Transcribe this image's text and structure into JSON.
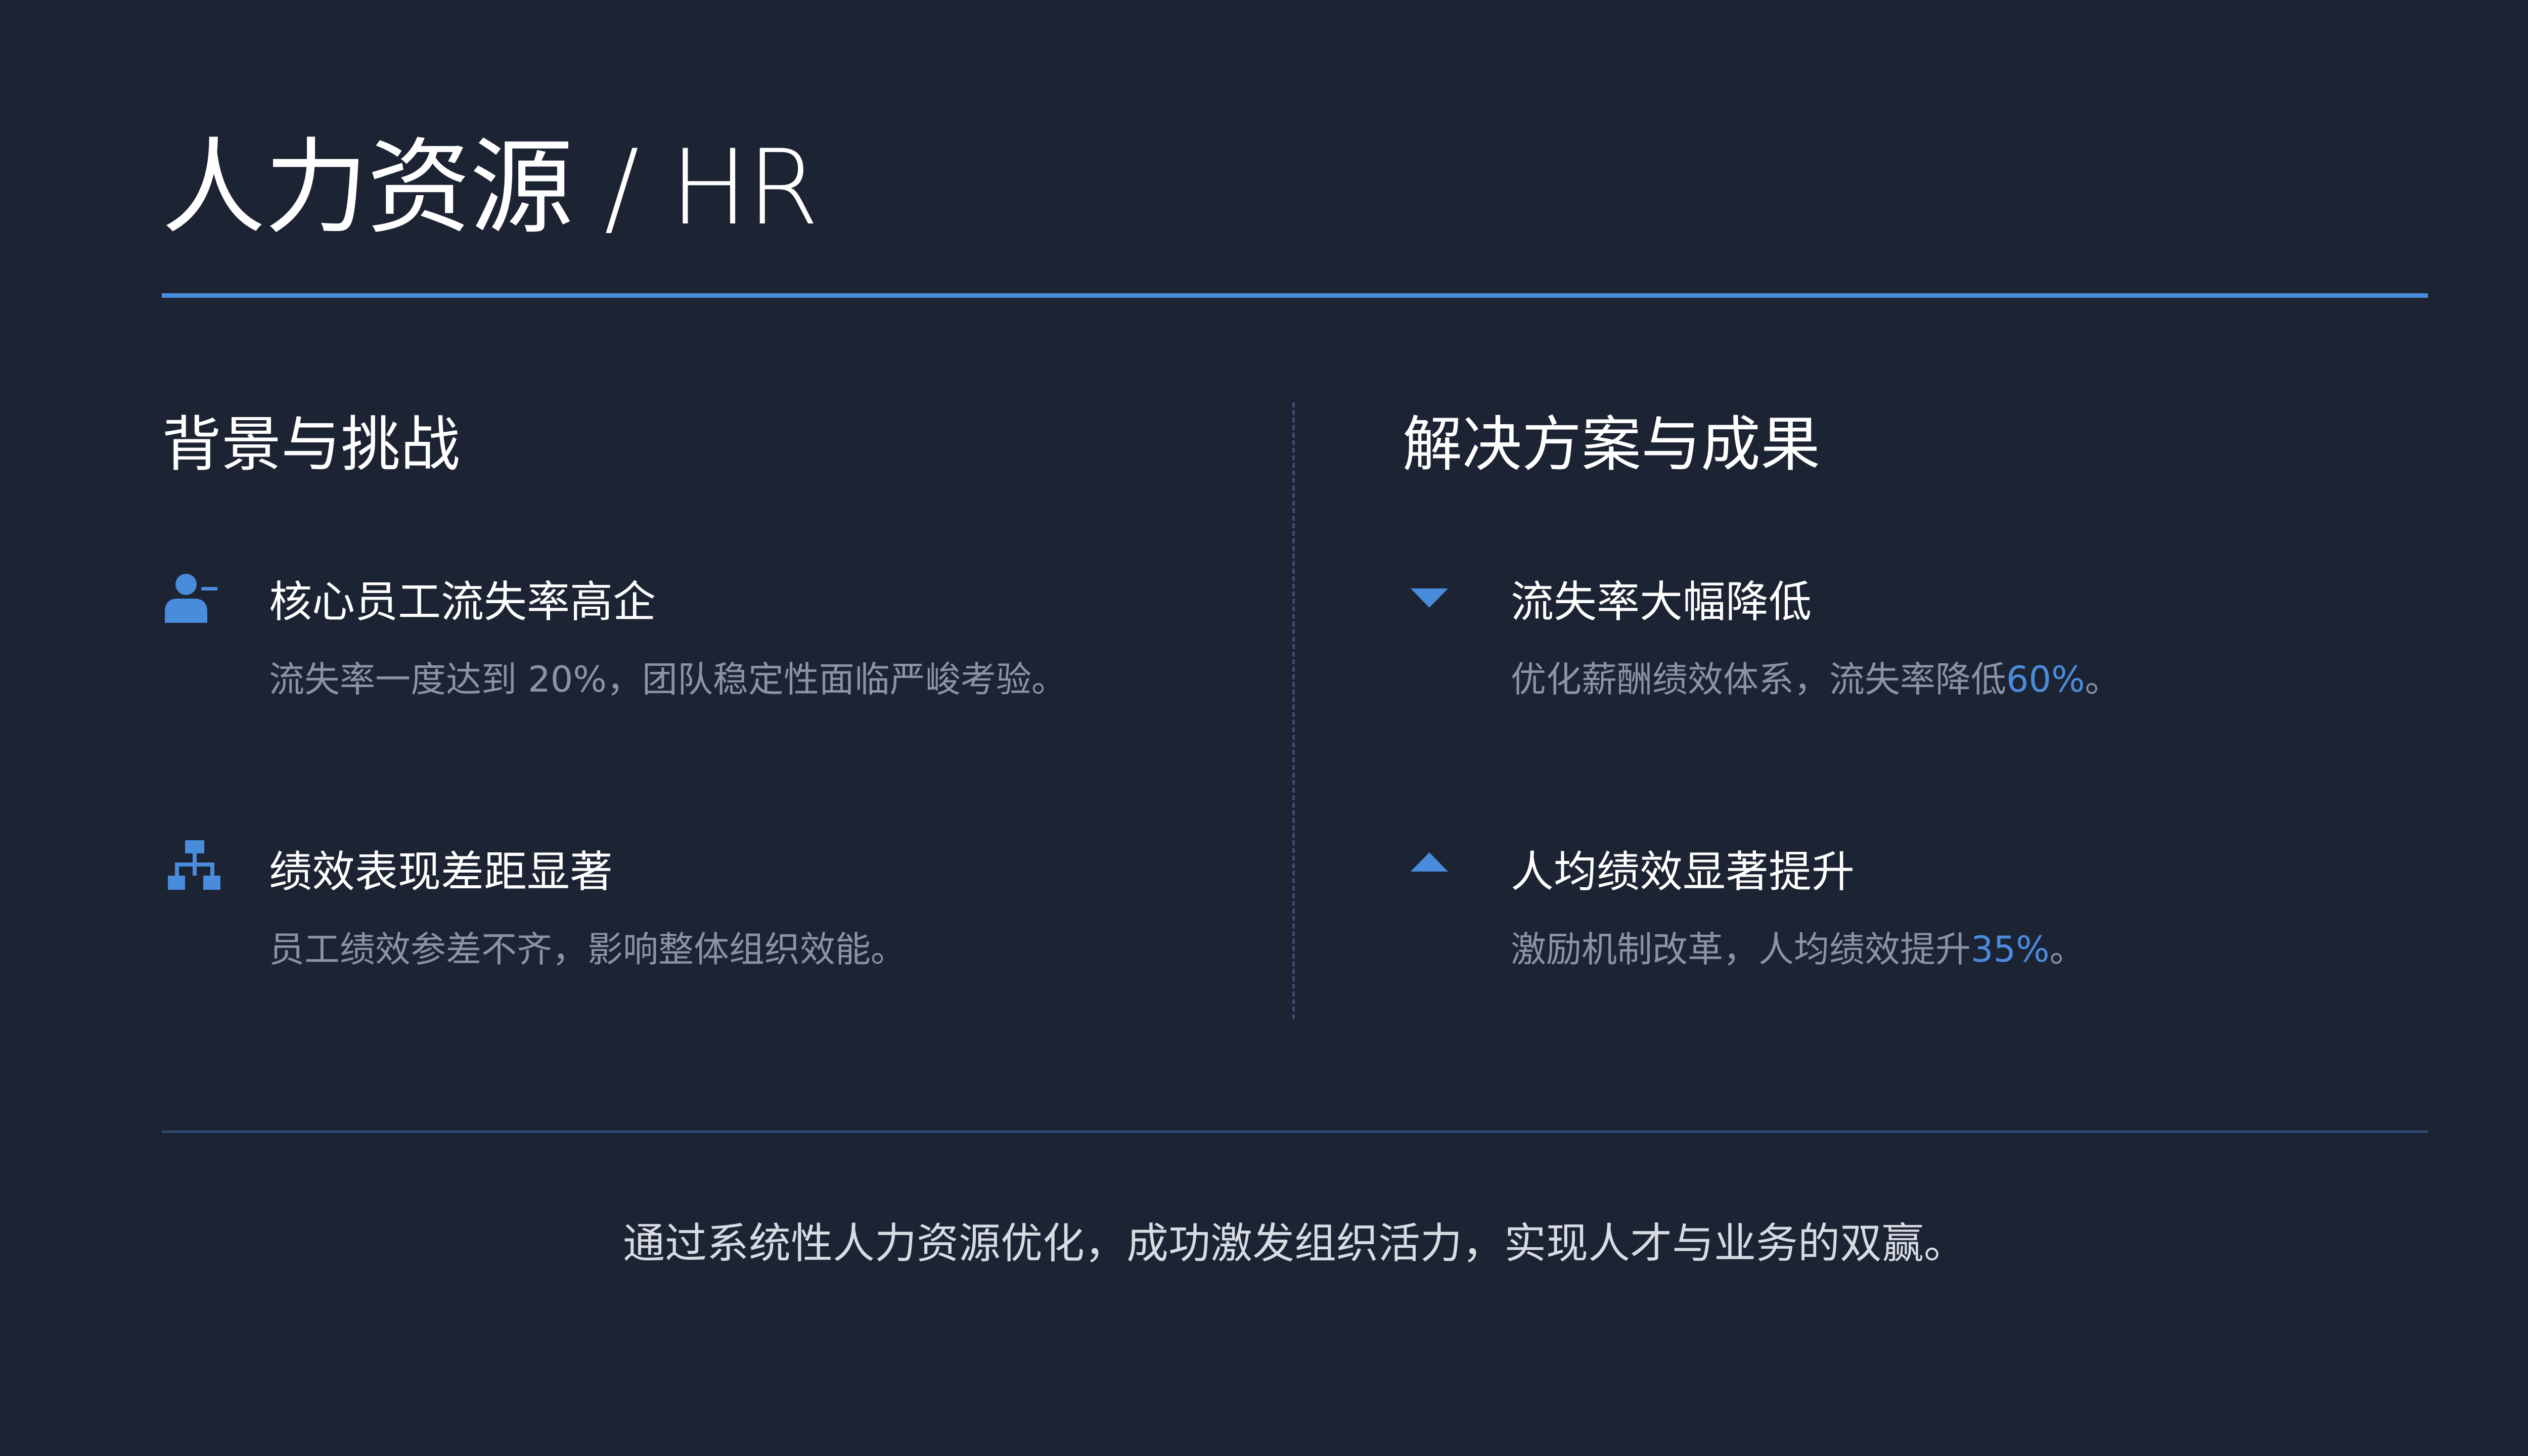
{
  "title": "人力资源 / HR",
  "left": {
    "heading": "背景与挑战",
    "items": [
      {
        "icon": "user-minus-icon",
        "title": "核心员工流失率高企",
        "desc": "流失率一度达到 20%，团队稳定性面临严峻考验。"
      },
      {
        "icon": "org-chart-icon",
        "title": "绩效表现差距显著",
        "desc": "员工绩效参差不齐，影响整体组织效能。"
      }
    ]
  },
  "right": {
    "heading": "解决方案与成果",
    "items": [
      {
        "icon": "caret-down-icon",
        "title": "流失率大幅降低",
        "desc_before": "优化薪酬绩效体系，流失率降低",
        "desc_highlight": "60%",
        "desc_after": "。"
      },
      {
        "icon": "caret-up-icon",
        "title": "人均绩效显著提升",
        "desc_before": "激励机制改革，人均绩效提升",
        "desc_highlight": "35%",
        "desc_after": "。"
      }
    ]
  },
  "footer": "通过系统性人力资源优化，成功激发组织活力，实现人才与业务的双赢。",
  "colors": {
    "background": "#1c2333",
    "accent": "#4a8cdc",
    "text": "#ffffff",
    "muted": "#8a94a6"
  }
}
